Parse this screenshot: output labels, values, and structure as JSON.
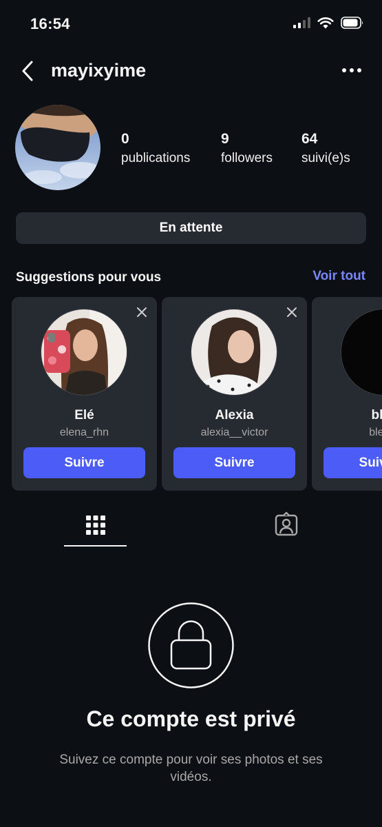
{
  "status_bar": {
    "time": "16:54",
    "icons": [
      "cellular-signal-icon",
      "wifi-icon",
      "battery-icon"
    ]
  },
  "header": {
    "username": "mayixyime",
    "icons": [
      "chevron-left-icon",
      "more-horizontal-icon"
    ]
  },
  "profile": {
    "stats": [
      {
        "value": "0",
        "label": "publications"
      },
      {
        "value": "9",
        "label": "followers"
      },
      {
        "value": "64",
        "label": "suivi(e)s"
      }
    ],
    "pending_button": "En attente"
  },
  "suggestions": {
    "title": "Suggestions pour vous",
    "see_all": "Voir tout",
    "cards": [
      {
        "name": "Elé",
        "handle": "elena_rhn",
        "button": "Suivre"
      },
      {
        "name": "Alexia",
        "handle": "alexia__victor",
        "button": "Suivre"
      },
      {
        "name": "blzu",
        "handle": "bleuer",
        "button": "Suivre e"
      }
    ]
  },
  "tabs": [
    "grid-icon",
    "tagged-person-icon"
  ],
  "private": {
    "title": "Ce compte est privé",
    "message": "Suivez ce compte pour voir ses photos et ses vidéos."
  },
  "colors": {
    "background": "#0c1014",
    "card": "#262a31",
    "accent_button": "#4c5cf7",
    "link": "#7a87ff",
    "secondary_text": "#a8a8a8"
  }
}
